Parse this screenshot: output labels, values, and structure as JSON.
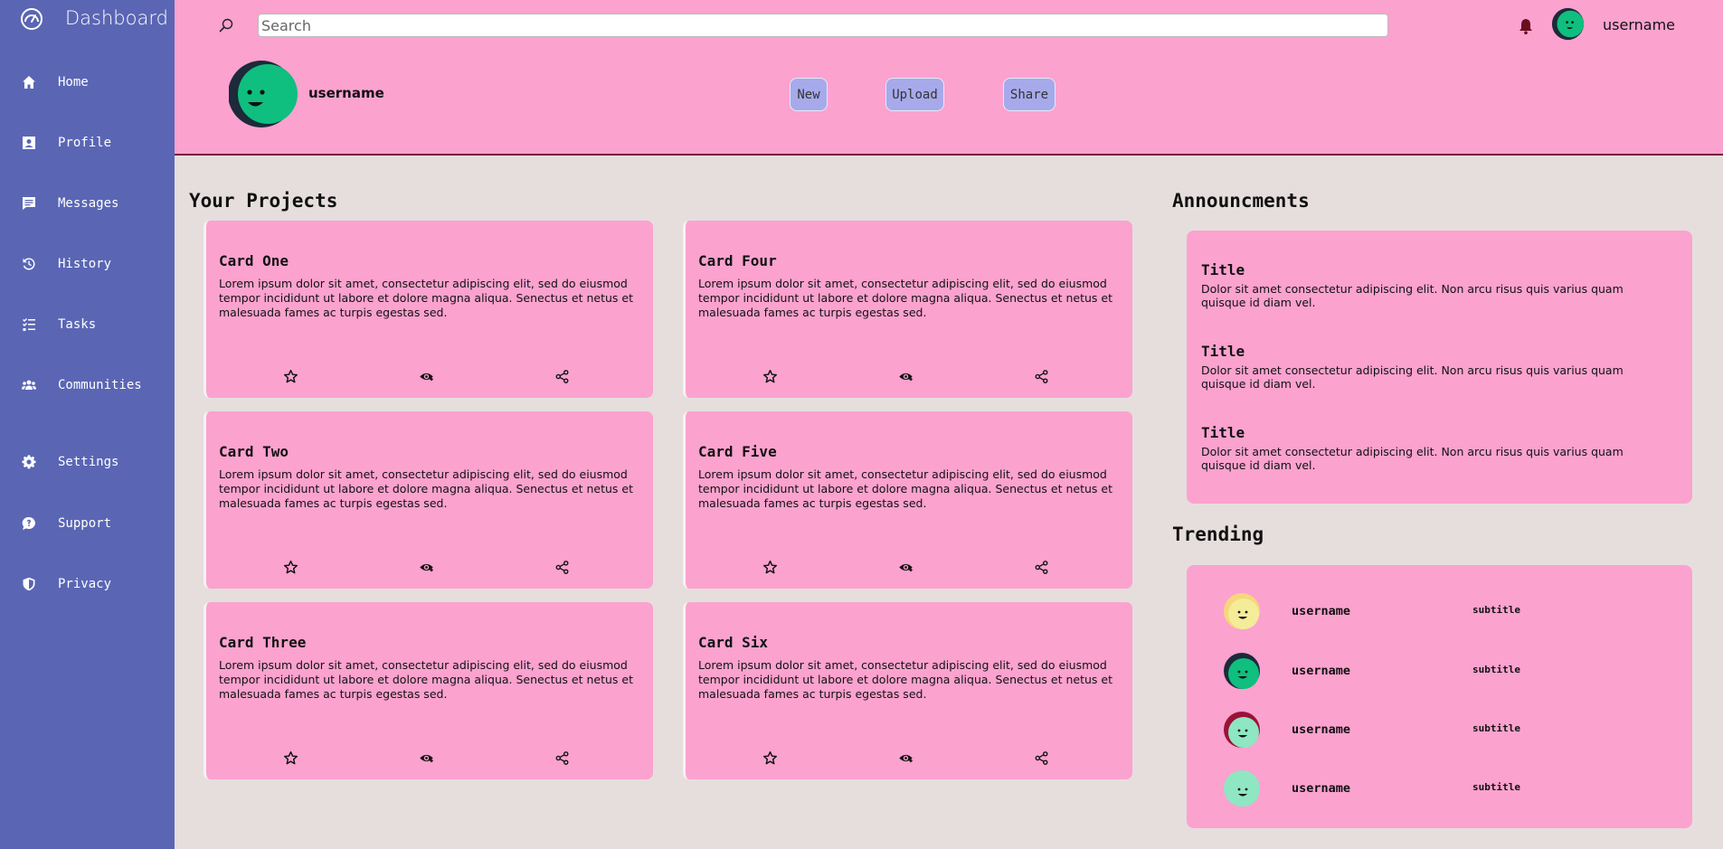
{
  "sidebar": {
    "brand": "Dashboard",
    "items": [
      {
        "label": "Home",
        "icon": "home-icon"
      },
      {
        "label": "Profile",
        "icon": "profile-icon"
      },
      {
        "label": "Messages",
        "icon": "messages-icon"
      },
      {
        "label": "History",
        "icon": "history-icon"
      },
      {
        "label": "Tasks",
        "icon": "tasks-icon"
      },
      {
        "label": "Communities",
        "icon": "communities-icon"
      },
      {
        "label": "Settings",
        "icon": "gear-icon"
      },
      {
        "label": "Support",
        "icon": "support-icon"
      },
      {
        "label": "Privacy",
        "icon": "shield-icon"
      }
    ]
  },
  "header": {
    "search_placeholder": "Search",
    "username": "username",
    "profile_username": "username",
    "buttons": {
      "new": "New",
      "upload": "Upload",
      "share": "Share"
    }
  },
  "projects": {
    "title": "Your Projects",
    "cards": [
      {
        "title": "Card One",
        "text": "Lorem ipsum dolor sit amet, consectetur adipiscing elit, sed do eiusmod tempor incididunt ut labore et dolore magna aliqua. Senectus et netus et malesuada fames ac turpis egestas sed."
      },
      {
        "title": "Card Two",
        "text": "Lorem ipsum dolor sit amet, consectetur adipiscing elit, sed do eiusmod tempor incididunt ut labore et dolore magna aliqua. Senectus et netus et malesuada fames ac turpis egestas sed."
      },
      {
        "title": "Card Three",
        "text": "Lorem ipsum dolor sit amet, consectetur adipiscing elit, sed do eiusmod tempor incididunt ut labore et dolore magna aliqua. Senectus et netus et malesuada fames ac turpis egestas sed."
      },
      {
        "title": "Card Four",
        "text": "Lorem ipsum dolor sit amet, consectetur adipiscing elit, sed do eiusmod tempor incididunt ut labore et dolore magna aliqua. Senectus et netus et malesuada fames ac turpis egestas sed."
      },
      {
        "title": "Card Five",
        "text": "Lorem ipsum dolor sit amet, consectetur adipiscing elit, sed do eiusmod tempor incididunt ut labore et dolore magna aliqua. Senectus et netus et malesuada fames ac turpis egestas sed."
      },
      {
        "title": "Card Six",
        "text": "Lorem ipsum dolor sit amet, consectetur adipiscing elit, sed do eiusmod tempor incididunt ut labore et dolore magna aliqua. Senectus et netus et malesuada fames ac turpis egestas sed."
      }
    ]
  },
  "announcements": {
    "title": "Announcments",
    "items": [
      {
        "title": "Title",
        "text": "Dolor sit amet consectetur adipiscing elit. Non arcu risus quis varius quam quisque id diam vel."
      },
      {
        "title": "Title",
        "text": "Dolor sit amet consectetur adipiscing elit. Non arcu risus quis varius quam quisque id diam vel."
      },
      {
        "title": "Title",
        "text": "Dolor sit amet consectetur adipiscing elit. Non arcu risus quis varius quam quisque id diam vel."
      }
    ]
  },
  "trending": {
    "title": "Trending",
    "items": [
      {
        "name": "username",
        "subtitle": "subtitle",
        "avatar_bg": "#f5d87a",
        "avatar_face": "#f5ec9a"
      },
      {
        "name": "username",
        "subtitle": "subtitle",
        "avatar_bg": "#1c2a3a",
        "avatar_face": "#0fbf7f"
      },
      {
        "name": "username",
        "subtitle": "subtitle",
        "avatar_bg": "#9a1238",
        "avatar_face": "#8fe6c2"
      },
      {
        "name": "username",
        "subtitle": "subtitle",
        "avatar_bg": "#8fe6c2",
        "avatar_face": "#8fe6c2"
      }
    ]
  },
  "colors": {
    "sidebar": "#5a66b4",
    "header": "#fba2cf",
    "background": "#e6dedd",
    "button": "#a6aaeb"
  }
}
